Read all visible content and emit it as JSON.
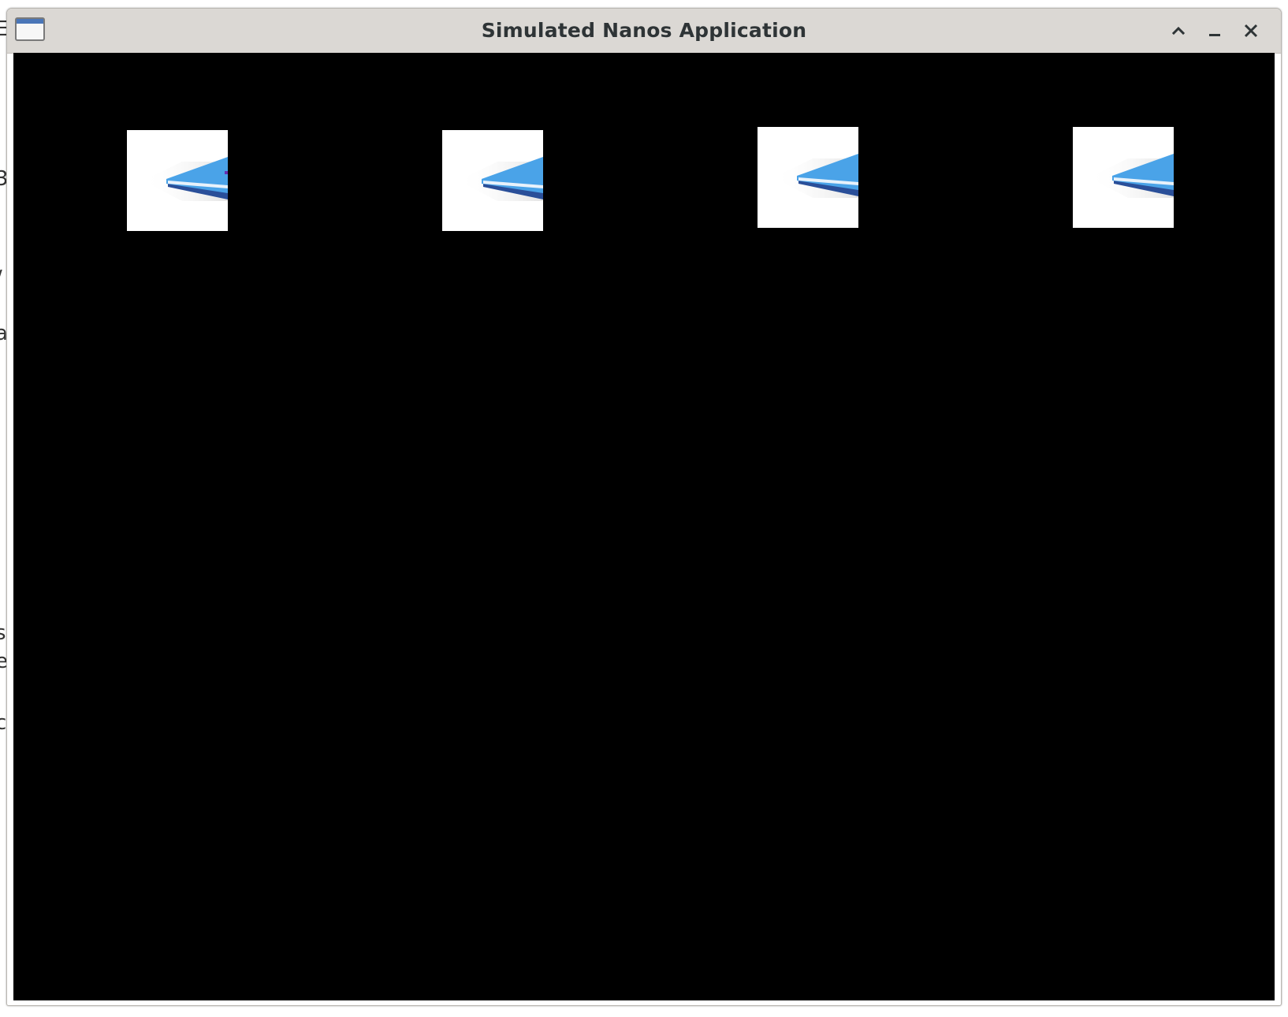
{
  "window": {
    "title": "Simulated Nanos Application"
  },
  "titlebar_buttons": [
    {
      "name": "maximize",
      "icon": "chevron-up-icon"
    },
    {
      "name": "minimize",
      "icon": "minimize-icon"
    },
    {
      "name": "close",
      "icon": "close-icon"
    }
  ],
  "canvas": {
    "background": "#000000",
    "sprites": [
      {
        "icon": "ship-sprite-icon"
      },
      {
        "icon": "ship-sprite-icon"
      },
      {
        "icon": "ship-sprite-icon"
      },
      {
        "icon": "ship-sprite-icon"
      }
    ]
  },
  "colors": {
    "titlebar": "#dbd8d4",
    "title_text": "#2e3436",
    "sprite_bg": "#ffffff",
    "sprite_blue": "#4aa3e8",
    "sprite_dark_blue": "#2a4f99"
  }
}
